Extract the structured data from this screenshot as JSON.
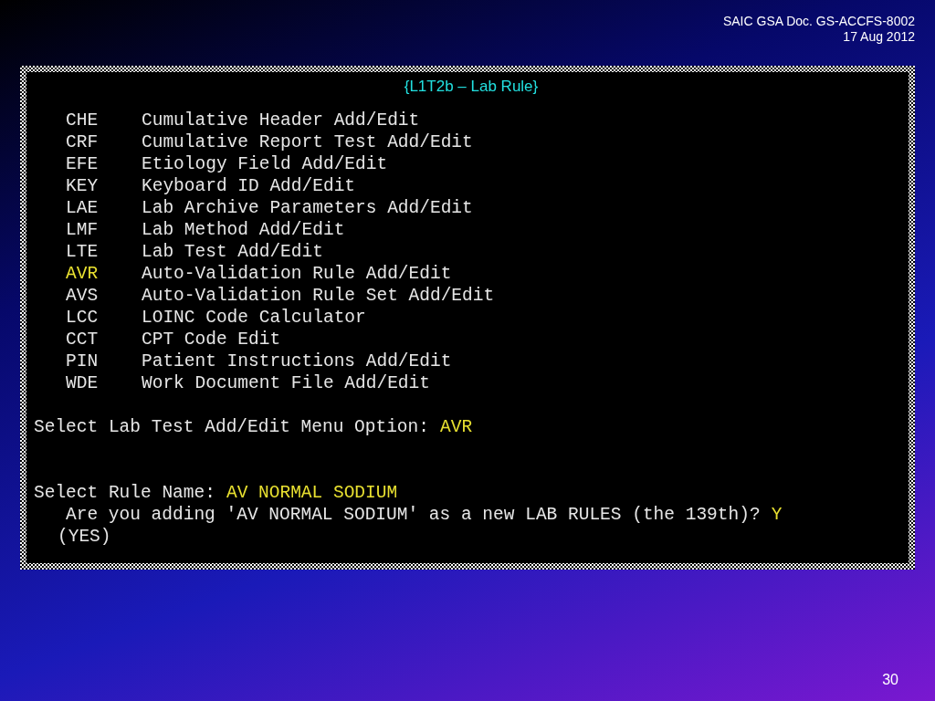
{
  "header": {
    "document": "SAIC GSA Doc. GS-ACCFS-8002",
    "date": "17 Aug 2012"
  },
  "terminal": {
    "title": "{L1T2b – Lab Rule}",
    "menu": [
      {
        "code": "CHE",
        "label": "Cumulative Header Add/Edit",
        "highlighted": false
      },
      {
        "code": "CRF",
        "label": "Cumulative Report Test Add/Edit",
        "highlighted": false
      },
      {
        "code": "EFE",
        "label": "Etiology Field Add/Edit",
        "highlighted": false
      },
      {
        "code": "KEY",
        "label": "Keyboard ID Add/Edit",
        "highlighted": false
      },
      {
        "code": "LAE",
        "label": "Lab Archive Parameters Add/Edit",
        "highlighted": false
      },
      {
        "code": "LMF",
        "label": "Lab Method Add/Edit",
        "highlighted": false
      },
      {
        "code": "LTE",
        "label": "Lab Test Add/Edit",
        "highlighted": false
      },
      {
        "code": "AVR",
        "label": "Auto-Validation Rule Add/Edit",
        "highlighted": true
      },
      {
        "code": "AVS",
        "label": "Auto-Validation Rule Set Add/Edit",
        "highlighted": false
      },
      {
        "code": "LCC",
        "label": "LOINC Code Calculator",
        "highlighted": false
      },
      {
        "code": "CCT",
        "label": "CPT Code Edit",
        "highlighted": false
      },
      {
        "code": "PIN",
        "label": "Patient Instructions Add/Edit",
        "highlighted": false
      },
      {
        "code": "WDE",
        "label": "Work Document File Add/Edit",
        "highlighted": false
      }
    ],
    "dialog": [
      {
        "kind": "prompt",
        "text": "Select Lab Test Add/Edit Menu Option:",
        "answer": "AVR"
      },
      {
        "kind": "prompt",
        "text": "Select Rule Name:",
        "answer": "AV NORMAL SODIUM"
      },
      {
        "kind": "question",
        "text": "Are you adding 'AV NORMAL SODIUM' as a new LAB RULES (the 139th)?",
        "answer": "Y"
      },
      {
        "kind": "echo",
        "text": "(YES)"
      }
    ]
  },
  "page_number": "30"
}
